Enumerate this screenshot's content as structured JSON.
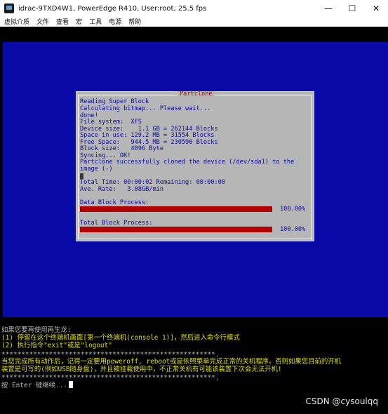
{
  "window": {
    "title": "idrac-9TXD4W1, PowerEdge R410, User:root, 25.5 fps",
    "controls": {
      "minimize": "—",
      "maximize": "☐",
      "close": "✕"
    }
  },
  "menu": {
    "items": [
      "虚拟介质",
      "文件",
      "查看",
      "宏",
      "工具",
      "电源",
      "帮助"
    ]
  },
  "partclone": {
    "title": "Partclone",
    "lines": [
      "Reading Super Block",
      "Calculating bitmap... Please wait...",
      "done!",
      "File system:  XFS",
      "Device size:    1.1 GB = 262144 Blocks",
      "Space in use: 129.2 MB = 31554 Blocks",
      "Free Space:   944.5 MB = 230590 Blocks",
      "Block size:   4096 Byte",
      "Syncing... OK!",
      "Partclone successfully cloned the device (/dev/sda1) to the",
      "image (-)"
    ],
    "time_line": "Total Time: 00:00:02 Remaining: 00:00:00",
    "rate_line": "Ave. Rate:   3.88GB/min",
    "data_block_label": "Data Block Process:",
    "data_block_percent": "100.00%",
    "data_block_progress": 1.0,
    "total_block_label": "Total Block Process:",
    "total_block_percent": "100.00%",
    "total_block_progress": 1.0,
    "colors": {
      "background": "#0a0aa8",
      "dialog": "#b6b6b6",
      "text": "#0a0a9a",
      "title": "#b80000",
      "bar": "#b50000"
    }
  },
  "terminal": {
    "lines": [
      "如果您要再使用再生龙:",
      "(1) 停留在这个终端机画面[第一个终端机(console 1)]，然后进入命令行模式",
      "(2) 执行指令\"exit\"或是\"logout\"",
      "******************************************************.",
      "当您完成所有动作后，记得一定要用poweroff, reboot或是依照菜单完成正常的关机程序。否则如果您目前的开机",
      "装置是可写的(例如USB随身盘)，并且被挂载使用中，不正常关机有可能该装置下次会无法开机!",
      "******************************************************.",
      "按 Enter 键继续..."
    ],
    "colors": {
      "normal": "#d8d8d8",
      "highlight": "#e0e000"
    }
  },
  "watermark": "CSDN @cysoulqq"
}
